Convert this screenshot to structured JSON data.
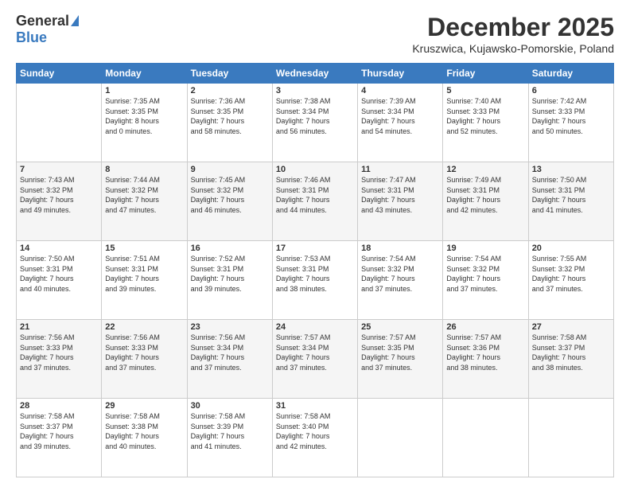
{
  "logo": {
    "general": "General",
    "blue": "Blue"
  },
  "title": {
    "month": "December 2025",
    "location": "Kruszwica, Kujawsko-Pomorskie, Poland"
  },
  "weekdays": [
    "Sunday",
    "Monday",
    "Tuesday",
    "Wednesday",
    "Thursday",
    "Friday",
    "Saturday"
  ],
  "weeks": [
    [
      {
        "day": "",
        "info": ""
      },
      {
        "day": "1",
        "info": "Sunrise: 7:35 AM\nSunset: 3:35 PM\nDaylight: 8 hours\nand 0 minutes."
      },
      {
        "day": "2",
        "info": "Sunrise: 7:36 AM\nSunset: 3:35 PM\nDaylight: 7 hours\nand 58 minutes."
      },
      {
        "day": "3",
        "info": "Sunrise: 7:38 AM\nSunset: 3:34 PM\nDaylight: 7 hours\nand 56 minutes."
      },
      {
        "day": "4",
        "info": "Sunrise: 7:39 AM\nSunset: 3:34 PM\nDaylight: 7 hours\nand 54 minutes."
      },
      {
        "day": "5",
        "info": "Sunrise: 7:40 AM\nSunset: 3:33 PM\nDaylight: 7 hours\nand 52 minutes."
      },
      {
        "day": "6",
        "info": "Sunrise: 7:42 AM\nSunset: 3:33 PM\nDaylight: 7 hours\nand 50 minutes."
      }
    ],
    [
      {
        "day": "7",
        "info": "Sunrise: 7:43 AM\nSunset: 3:32 PM\nDaylight: 7 hours\nand 49 minutes."
      },
      {
        "day": "8",
        "info": "Sunrise: 7:44 AM\nSunset: 3:32 PM\nDaylight: 7 hours\nand 47 minutes."
      },
      {
        "day": "9",
        "info": "Sunrise: 7:45 AM\nSunset: 3:32 PM\nDaylight: 7 hours\nand 46 minutes."
      },
      {
        "day": "10",
        "info": "Sunrise: 7:46 AM\nSunset: 3:31 PM\nDaylight: 7 hours\nand 44 minutes."
      },
      {
        "day": "11",
        "info": "Sunrise: 7:47 AM\nSunset: 3:31 PM\nDaylight: 7 hours\nand 43 minutes."
      },
      {
        "day": "12",
        "info": "Sunrise: 7:49 AM\nSunset: 3:31 PM\nDaylight: 7 hours\nand 42 minutes."
      },
      {
        "day": "13",
        "info": "Sunrise: 7:50 AM\nSunset: 3:31 PM\nDaylight: 7 hours\nand 41 minutes."
      }
    ],
    [
      {
        "day": "14",
        "info": "Sunrise: 7:50 AM\nSunset: 3:31 PM\nDaylight: 7 hours\nand 40 minutes."
      },
      {
        "day": "15",
        "info": "Sunrise: 7:51 AM\nSunset: 3:31 PM\nDaylight: 7 hours\nand 39 minutes."
      },
      {
        "day": "16",
        "info": "Sunrise: 7:52 AM\nSunset: 3:31 PM\nDaylight: 7 hours\nand 39 minutes."
      },
      {
        "day": "17",
        "info": "Sunrise: 7:53 AM\nSunset: 3:31 PM\nDaylight: 7 hours\nand 38 minutes."
      },
      {
        "day": "18",
        "info": "Sunrise: 7:54 AM\nSunset: 3:32 PM\nDaylight: 7 hours\nand 37 minutes."
      },
      {
        "day": "19",
        "info": "Sunrise: 7:54 AM\nSunset: 3:32 PM\nDaylight: 7 hours\nand 37 minutes."
      },
      {
        "day": "20",
        "info": "Sunrise: 7:55 AM\nSunset: 3:32 PM\nDaylight: 7 hours\nand 37 minutes."
      }
    ],
    [
      {
        "day": "21",
        "info": "Sunrise: 7:56 AM\nSunset: 3:33 PM\nDaylight: 7 hours\nand 37 minutes."
      },
      {
        "day": "22",
        "info": "Sunrise: 7:56 AM\nSunset: 3:33 PM\nDaylight: 7 hours\nand 37 minutes."
      },
      {
        "day": "23",
        "info": "Sunrise: 7:56 AM\nSunset: 3:34 PM\nDaylight: 7 hours\nand 37 minutes."
      },
      {
        "day": "24",
        "info": "Sunrise: 7:57 AM\nSunset: 3:34 PM\nDaylight: 7 hours\nand 37 minutes."
      },
      {
        "day": "25",
        "info": "Sunrise: 7:57 AM\nSunset: 3:35 PM\nDaylight: 7 hours\nand 37 minutes."
      },
      {
        "day": "26",
        "info": "Sunrise: 7:57 AM\nSunset: 3:36 PM\nDaylight: 7 hours\nand 38 minutes."
      },
      {
        "day": "27",
        "info": "Sunrise: 7:58 AM\nSunset: 3:37 PM\nDaylight: 7 hours\nand 38 minutes."
      }
    ],
    [
      {
        "day": "28",
        "info": "Sunrise: 7:58 AM\nSunset: 3:37 PM\nDaylight: 7 hours\nand 39 minutes."
      },
      {
        "day": "29",
        "info": "Sunrise: 7:58 AM\nSunset: 3:38 PM\nDaylight: 7 hours\nand 40 minutes."
      },
      {
        "day": "30",
        "info": "Sunrise: 7:58 AM\nSunset: 3:39 PM\nDaylight: 7 hours\nand 41 minutes."
      },
      {
        "day": "31",
        "info": "Sunrise: 7:58 AM\nSunset: 3:40 PM\nDaylight: 7 hours\nand 42 minutes."
      },
      {
        "day": "",
        "info": ""
      },
      {
        "day": "",
        "info": ""
      },
      {
        "day": "",
        "info": ""
      }
    ]
  ]
}
